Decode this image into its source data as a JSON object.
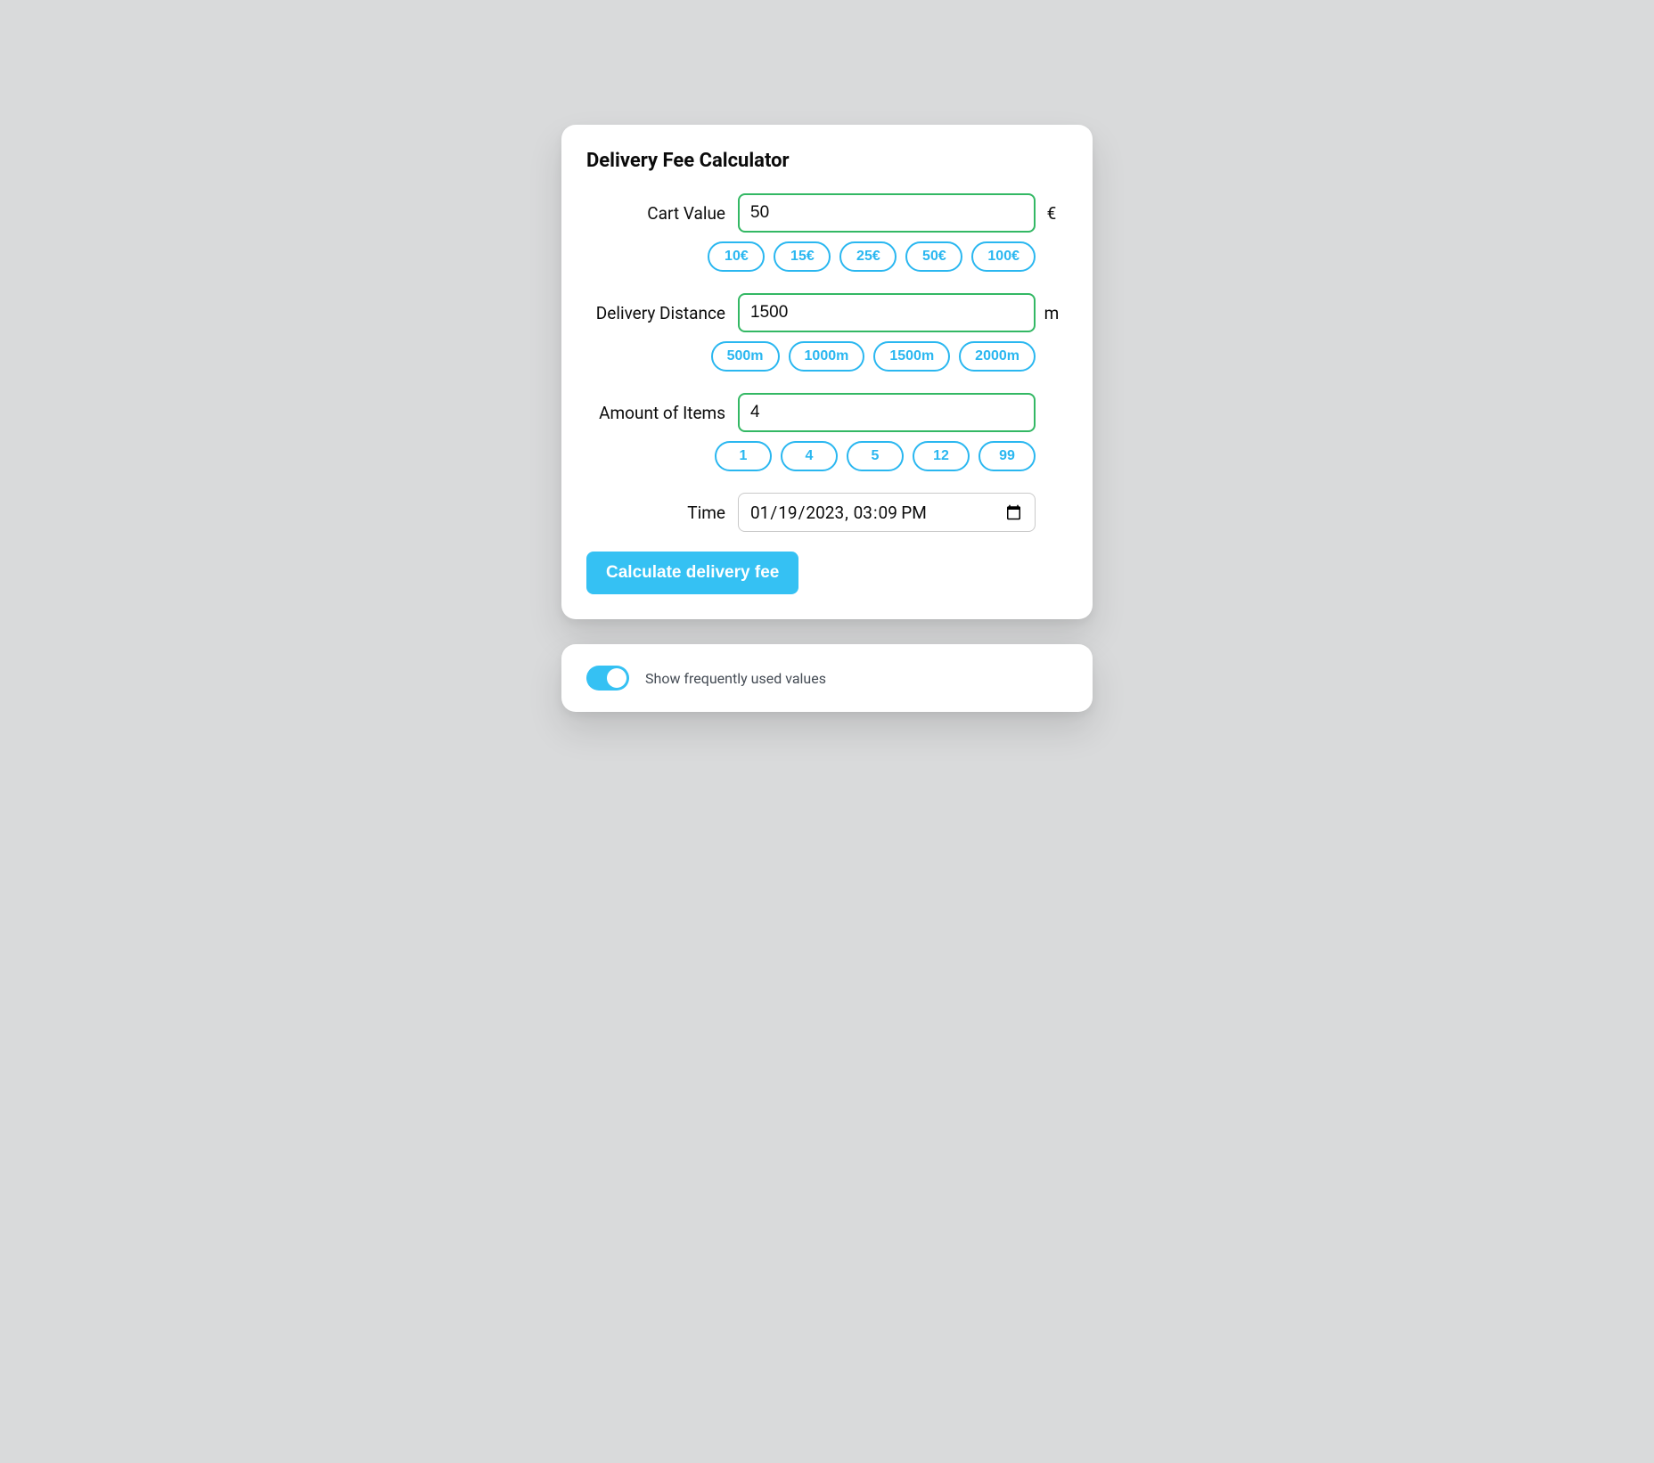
{
  "title": "Delivery Fee Calculator",
  "fields": {
    "cartValue": {
      "label": "Cart Value",
      "value": "50",
      "unit": "€",
      "presets": [
        "10€",
        "15€",
        "25€",
        "50€",
        "100€"
      ]
    },
    "distance": {
      "label": "Delivery Distance",
      "value": "1500",
      "unit": "m",
      "presets": [
        "500m",
        "1000m",
        "1500m",
        "2000m"
      ]
    },
    "items": {
      "label": "Amount of Items",
      "value": "4",
      "unit": "",
      "presets": [
        "1",
        "4",
        "5",
        "12",
        "99"
      ]
    },
    "time": {
      "label": "Time",
      "value": "2023-01-19T15:09"
    }
  },
  "calculateLabel": "Calculate delivery fee",
  "toggle": {
    "label": "Show frequently used values",
    "on": true
  }
}
